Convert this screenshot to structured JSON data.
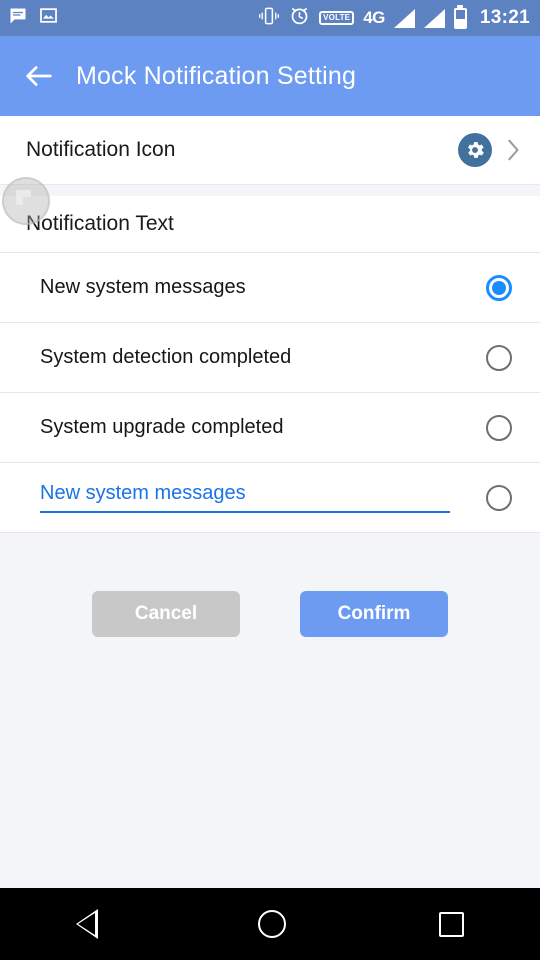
{
  "statusbar": {
    "icons_left": [
      "message-icon",
      "image-icon"
    ],
    "icons_right": [
      "vibrate-icon",
      "alarm-icon",
      "volte-badge",
      "network-type",
      "signal-1-icon",
      "signal-2-icon",
      "battery-icon"
    ],
    "volte_label": "VOLTE",
    "network_type": "4G",
    "clock": "13:21"
  },
  "appbar": {
    "back_icon": "back-arrow-icon",
    "title": "Mock Notification Setting",
    "background": "#6D9BF1"
  },
  "icon_row": {
    "label": "Notification Icon",
    "gear_icon": "gear-icon",
    "gear_background": "#41719C",
    "chevron_icon": "chevron-right-icon"
  },
  "floating_bubble": {
    "icon": "overlapping-squares-icon"
  },
  "section": {
    "title": "Notification Text"
  },
  "options": [
    {
      "label": "New system messages",
      "selected": true
    },
    {
      "label": "System detection completed",
      "selected": false
    },
    {
      "label": "System upgrade completed",
      "selected": false
    }
  ],
  "custom_option": {
    "value": "New system messages",
    "placeholder": "New system messages",
    "selected": false,
    "accent": "#1A73E8"
  },
  "buttons": {
    "cancel_label": "Cancel",
    "cancel_color": "#C8C8C8",
    "confirm_label": "Confirm",
    "confirm_color": "#6D9BF1"
  },
  "navbar": {
    "back": "nav-back-icon",
    "home": "nav-home-icon",
    "recents": "nav-recents-icon"
  }
}
